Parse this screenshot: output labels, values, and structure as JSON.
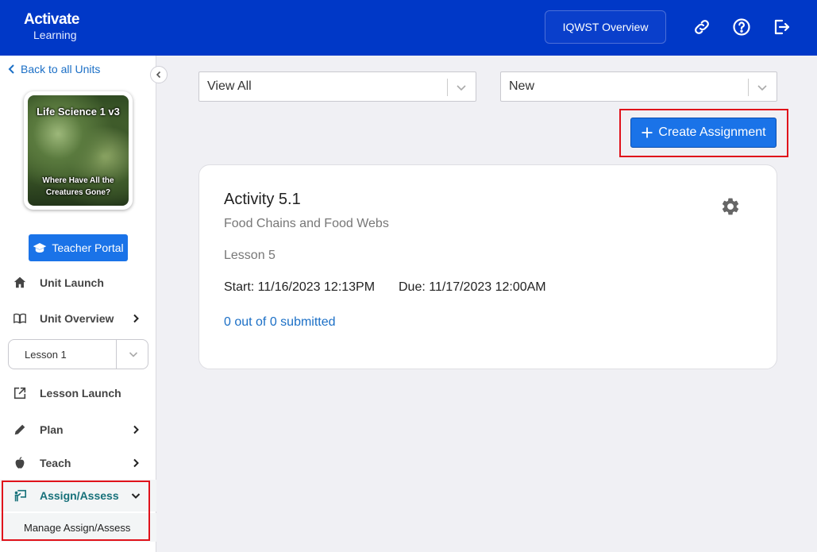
{
  "header": {
    "logo_line1": "Activate",
    "logo_line2": "Learning",
    "overview_button": "IQWST Overview",
    "icons": [
      "link-icon",
      "help-icon",
      "logout-icon"
    ],
    "color": "#0038c7"
  },
  "sidebar": {
    "back_link": "Back to all Units",
    "cover_title": "Life Science 1 v3",
    "cover_subtitle": "Where Have All the Creatures Gone?",
    "teacher_portal": "Teacher Portal",
    "lesson_select_value": "Lesson 1",
    "items": [
      {
        "label": "Unit Launch",
        "icon": "home-icon"
      },
      {
        "label": "Unit Overview",
        "icon": "book-icon"
      },
      {
        "label": "Lesson Launch",
        "icon": "external-link-icon"
      },
      {
        "label": "Plan",
        "icon": "pencil-icon"
      },
      {
        "label": "Teach",
        "icon": "apple-icon"
      },
      {
        "label": "Assign/Assess",
        "icon": "presenter-icon"
      }
    ],
    "sub_item": "Manage Assign/Assess"
  },
  "main": {
    "filter1_value": "View All",
    "filter2_value": "New",
    "create_button": "Create Assignment",
    "card": {
      "title": "Activity 5.1",
      "subtitle": "Food Chains and Food Webs",
      "lesson": "Lesson 5",
      "start": "Start: 11/16/2023 12:13PM",
      "due": "Due: 11/17/2023 12:00AM",
      "submitted": "0 out of 0 submitted"
    }
  },
  "colors": {
    "accent": "#1a73e8",
    "active_nav": "#17717a",
    "highlight": "#e0121b"
  }
}
